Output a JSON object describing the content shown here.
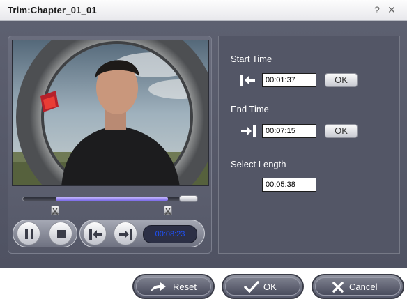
{
  "window": {
    "title": "Trim:Chapter_01_01"
  },
  "titlebar": {
    "help_label": "?",
    "close_label": "✕"
  },
  "trim": {
    "start_label": "Start Time",
    "start_value": "00:01:37",
    "end_label": "End Time",
    "end_value": "00:07:15",
    "length_label": "Select Length",
    "length_value": "00:05:38",
    "ok_label": "OK"
  },
  "player": {
    "current_time": "00:08:23",
    "selection_start_fraction": 0.19,
    "selection_end_fraction": 0.84
  },
  "footer": {
    "reset_label": "Reset",
    "ok_label": "OK",
    "cancel_label": "Cancel"
  },
  "icons": {
    "set_start": "set-start-icon",
    "set_end": "set-end-icon",
    "pause": "pause-icon",
    "stop": "stop-icon",
    "reset": "reset-arrow-icon",
    "ok": "checkmark-icon",
    "cancel": "x-icon",
    "marker": "scissors-icon"
  },
  "colors": {
    "panel_bg": "#5c5f6e",
    "slider_range": "#8d7cf0",
    "time_display_text": "#1e52ff"
  }
}
